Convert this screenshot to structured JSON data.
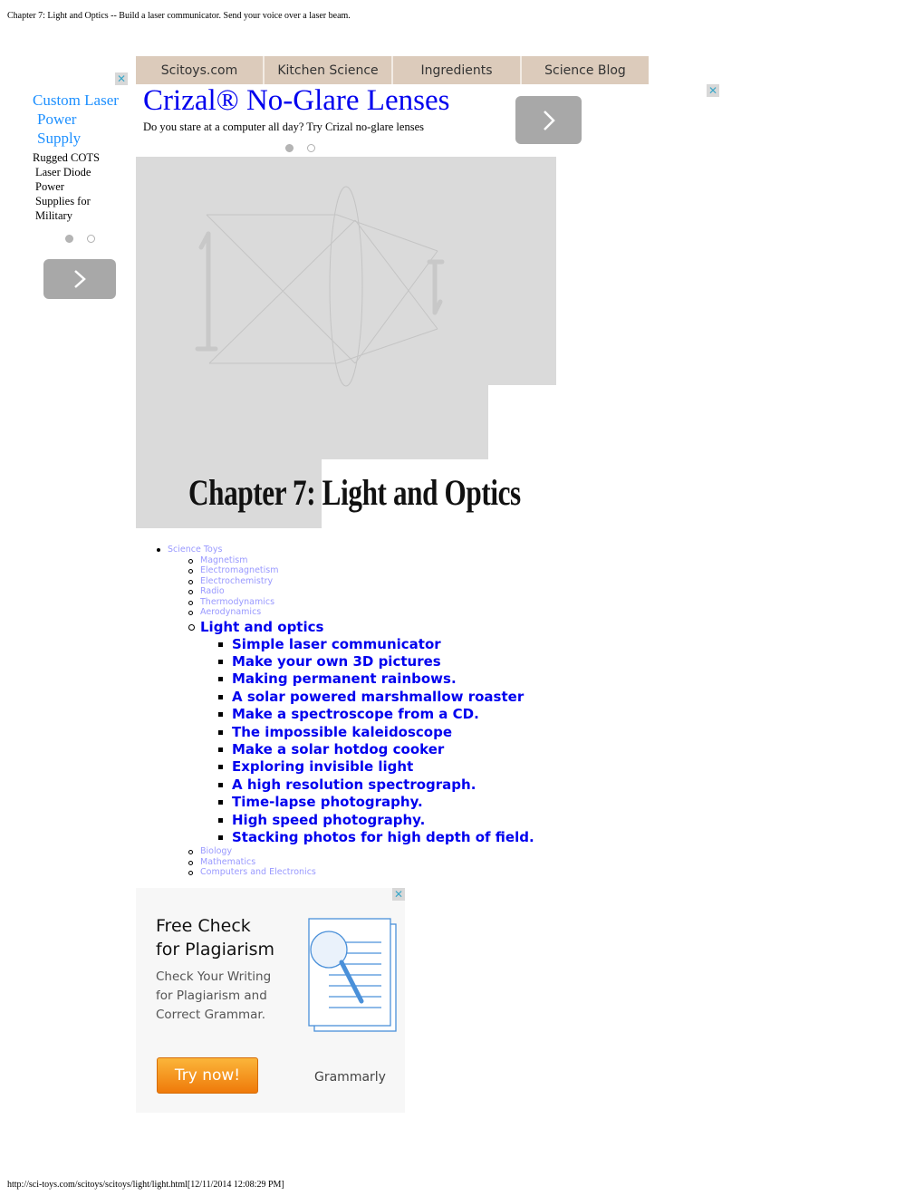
{
  "page": {
    "header_text": "Chapter 7: Light and Optics -- Build a laser communicator. Send your voice over a laser beam.",
    "footer_text": "http://sci-toys.com/scitoys/scitoys/light/light.html[12/11/2014 12:08:29 PM]"
  },
  "nav": {
    "items": [
      {
        "label": "Scitoys.com"
      },
      {
        "label": "Kitchen Science"
      },
      {
        "label": "Ingredients"
      },
      {
        "label": "Science Blog"
      }
    ],
    "background": "#dccbbb"
  },
  "left_ad": {
    "close_icon": "close-x-icon",
    "title_lines": [
      "Custom Laser",
      "Power",
      "Supply"
    ],
    "body_lines": [
      "Rugged COTS",
      "Laser Diode",
      "Power",
      "Supplies for",
      "Military"
    ],
    "dots": [
      {
        "active": true
      },
      {
        "active": false
      }
    ],
    "next_icon": "chevron-right-icon",
    "title_color": "#1e90ff"
  },
  "top_ad": {
    "title": "Crizal® No-Glare Lenses",
    "body": "Do you stare at a computer all day? Try Crizal no-glare lenses",
    "dots": [
      {
        "active": true
      },
      {
        "active": false
      }
    ],
    "next_icon": "chevron-right-icon",
    "close_icon": "close-x-icon",
    "title_color": "#0000ee"
  },
  "hero": {
    "title": "Chapter 7: Light and Optics",
    "diagram": "lens-ray-diagram"
  },
  "tree": {
    "root": "Science Toys",
    "before": [
      "Magnetism",
      "Electromagnetism",
      "Electrochemistry",
      "Radio",
      "Thermodynamics",
      "Aerodynamics"
    ],
    "current": "Light and optics",
    "children": [
      "Simple laser communicator",
      "Make your own 3D pictures",
      "Making permanent rainbows.",
      "A solar powered marshmallow roaster",
      "Make a spectroscope from a CD.",
      "The impossible kaleidoscope",
      "Make a solar hotdog cooker",
      "Exploring invisible light",
      "A high resolution spectrograph.",
      "Time-lapse photography.",
      "High speed photography.",
      "Stacking photos for high depth of field."
    ],
    "after": [
      "Biology",
      "Mathematics",
      "Computers and Electronics"
    ]
  },
  "grammarly_ad": {
    "headline_lines": [
      "Free Check",
      "for Plagiarism"
    ],
    "sub_lines": [
      "Check Your Writing",
      "for Plagiarism and",
      "Correct Grammar."
    ],
    "button": "Try now!",
    "brand": "Grammarly",
    "close_icon": "close-x-icon",
    "art": "magnifier-document-icon"
  }
}
